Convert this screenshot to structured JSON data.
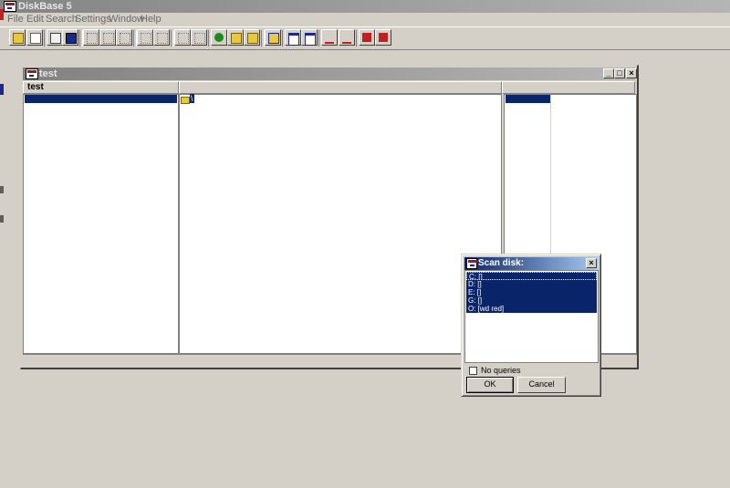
{
  "app": {
    "title": "DiskBase 5"
  },
  "menu": {
    "items": [
      "File",
      "Edit",
      "Search",
      "Settings",
      "Window",
      "Help"
    ]
  },
  "toolbar": {
    "buttons": [
      "open-folder-icon",
      "print-icon",
      "import-icon",
      "catalog-icon",
      "scan-icon",
      "scan-update-icon",
      "scan-list-icon",
      "copy-icon",
      "move-icon",
      "delete-icon",
      "properties-icon",
      "tree-icon",
      "new-folder-icon",
      "edit-folder-icon",
      "find-icon",
      "view-panes-icon",
      "view-list-icon",
      "link-icon",
      "unlink-icon",
      "export-icon",
      "export-all-icon"
    ]
  },
  "child_window": {
    "title": "test",
    "column_header": "test",
    "folder_label": "\\",
    "controls": {
      "minimize": "_",
      "maximize": "□",
      "close": "×"
    }
  },
  "scan_dialog": {
    "title": "Scan disk:",
    "drives": [
      "C: []",
      "D: []",
      "E: []",
      "G: []",
      "O: [wd red]"
    ],
    "no_queries_label": "No queries",
    "no_queries_checked": false,
    "ok_label": "OK",
    "cancel_label": "Cancel",
    "close_glyph": "×"
  },
  "colors": {
    "face": "#d4d0c8",
    "selection": "#0a246a",
    "active_title_start": "#0a246a",
    "active_title_end": "#a6caf0",
    "inactive_title": "#828282"
  }
}
